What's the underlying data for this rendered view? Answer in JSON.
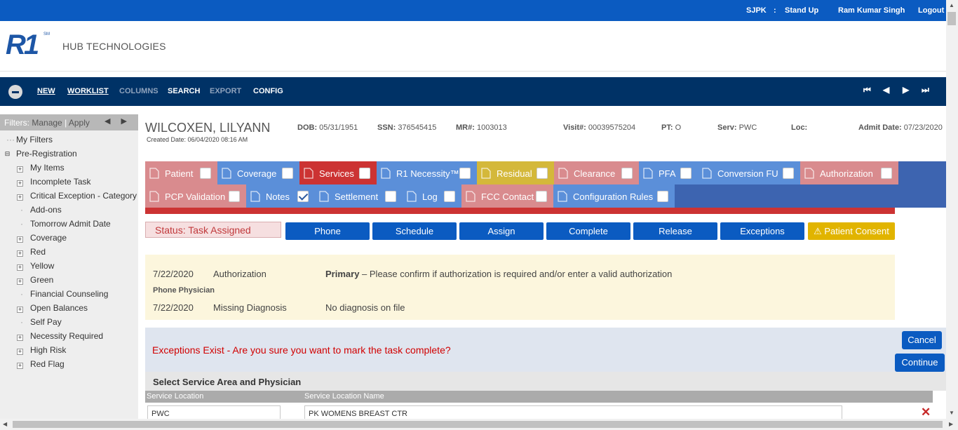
{
  "topbar": {
    "site": "SJPK",
    "separator": ":",
    "meeting": "Stand Up",
    "user": "Ram Kumar Singh",
    "logout": "Logout"
  },
  "brand": {
    "logo": "R1",
    "tm": "SM",
    "company": "HUB TECHNOLOGIES",
    "color": "#1d56a6"
  },
  "nav": {
    "items": [
      {
        "label": "NEW",
        "accesskey": "N"
      },
      {
        "label": "WORKLIST",
        "accesskey": "W"
      },
      {
        "label": "COLUMNS",
        "disabled": true
      },
      {
        "label": "SEARCH"
      },
      {
        "label": "EXPORT",
        "disabled": true
      },
      {
        "label": "CONFIG"
      }
    ],
    "pager_icons": [
      "first-page-icon",
      "prev-page-icon",
      "next-page-icon",
      "last-page-icon"
    ],
    "pager_glyphs": [
      "⏮",
      "◀",
      "▶",
      "⏭"
    ]
  },
  "sidebar": {
    "filters_label": "Filters:",
    "manage": "Manage",
    "divider": "|",
    "apply": "Apply",
    "arrows": "◀ ▶",
    "my_filters": "My Filters",
    "root": "Pre-Registration",
    "items": [
      {
        "label": "My Items",
        "expandable": true
      },
      {
        "label": "Incomplete Task",
        "expandable": true
      },
      {
        "label": "Critical Exception - Category",
        "expandable": true
      },
      {
        "label": "Add-ons",
        "expandable": false
      },
      {
        "label": "Tomorrow Admit Date",
        "expandable": false
      },
      {
        "label": "Coverage",
        "expandable": true
      },
      {
        "label": "Red",
        "expandable": true
      },
      {
        "label": "Yellow",
        "expandable": true
      },
      {
        "label": "Green",
        "expandable": true
      },
      {
        "label": "Financial Counseling",
        "expandable": false
      },
      {
        "label": "Open Balances",
        "expandable": true
      },
      {
        "label": "Self Pay",
        "expandable": false
      },
      {
        "label": "Necessity Required",
        "expandable": true
      },
      {
        "label": "High Risk",
        "expandable": true
      },
      {
        "label": "Red Flag",
        "expandable": true
      }
    ]
  },
  "patient": {
    "name": "WILCOXEN, LILYANN",
    "created": "Created Date: 06/04/2020 08:16 AM",
    "fields": [
      {
        "label": "DOB:",
        "value": "05/31/1951"
      },
      {
        "label": "SSN:",
        "value": "376545415"
      },
      {
        "label": "MR#:",
        "value": "1003013"
      },
      {
        "label": "Visit#:",
        "value": "00039575204"
      },
      {
        "label": "PT:",
        "value": "O"
      },
      {
        "label": "Serv:",
        "value": "PWC"
      },
      {
        "label": "Loc:",
        "value": ""
      },
      {
        "label": "Admit Date:",
        "value": "07/23/2020"
      }
    ]
  },
  "tabs": [
    {
      "label": "Patient",
      "icon": "person-icon",
      "color": "#d98b8e",
      "checked": false
    },
    {
      "label": "Coverage",
      "icon": "umbrella-icon",
      "color": "#5b8fd9",
      "checked": false
    },
    {
      "label": "Services",
      "icon": "stethoscope-icon",
      "color": "#cc3333",
      "checked": false
    },
    {
      "label": "R1 Necessity™",
      "icon": "document-icon",
      "color": "#5b8fd9",
      "checked": false
    },
    {
      "label": "Residual",
      "icon": "puzzle-icon",
      "color": "#d4b83a",
      "checked": false
    },
    {
      "label": "Clearance",
      "icon": "document-icon",
      "color": "#d98b8e",
      "checked": false
    },
    {
      "label": "PFA",
      "icon": "help-icon",
      "color": "#5b8fd9",
      "checked": false
    },
    {
      "label": "Conversion FU",
      "icon": "document-icon",
      "color": "#5b8fd9",
      "checked": false
    },
    {
      "label": "Authorization",
      "icon": "key-icon",
      "color": "#d98b8e",
      "checked": false
    },
    {
      "label": "PCP Validation",
      "icon": "document-icon",
      "color": "#d98b8e",
      "checked": false
    },
    {
      "label": "Notes",
      "icon": "notes-icon",
      "color": "#5b8fd9",
      "checked": true
    },
    {
      "label": "Settlement",
      "icon": "money-icon",
      "color": "#5b8fd9",
      "checked": false
    },
    {
      "label": "Log",
      "icon": "list-icon",
      "color": "#5b8fd9",
      "checked": false
    },
    {
      "label": "FCC Contact",
      "icon": "document-icon",
      "color": "#d98b8e",
      "checked": false
    },
    {
      "label": "Configuration Rules",
      "icon": "document-icon",
      "color": "#5b8fd9",
      "checked": false
    }
  ],
  "status": {
    "text": "Status: Task Assigned"
  },
  "actions": {
    "phone": "Phone",
    "schedule": "Schedule",
    "assign": "Assign",
    "complete": "Complete",
    "release": "Release",
    "exceptions": "Exceptions",
    "consent": "Patient Consent",
    "consent_glyph": "⚠"
  },
  "notices": [
    {
      "date": "7/22/2020",
      "type": "Authorization",
      "strong": "Primary",
      "dash": " – ",
      "message": "Please confirm if authorization is required and/or enter a valid authorization"
    },
    {
      "group": "Phone Physician"
    },
    {
      "date": "7/22/2020",
      "type": "Missing Diagnosis",
      "message": "No diagnosis on file"
    }
  ],
  "confirm": {
    "message": "Exceptions Exist - Are you sure you want to mark the task complete?",
    "cancel": "Cancel",
    "continue": "Continue"
  },
  "service": {
    "title": "Select Service Area and Physician",
    "col_location": "Service Location",
    "col_name": "Service Location Name",
    "location_value": "PWC",
    "name_value": "PK WOMENS BREAST CTR",
    "delete_glyph": "✕"
  }
}
